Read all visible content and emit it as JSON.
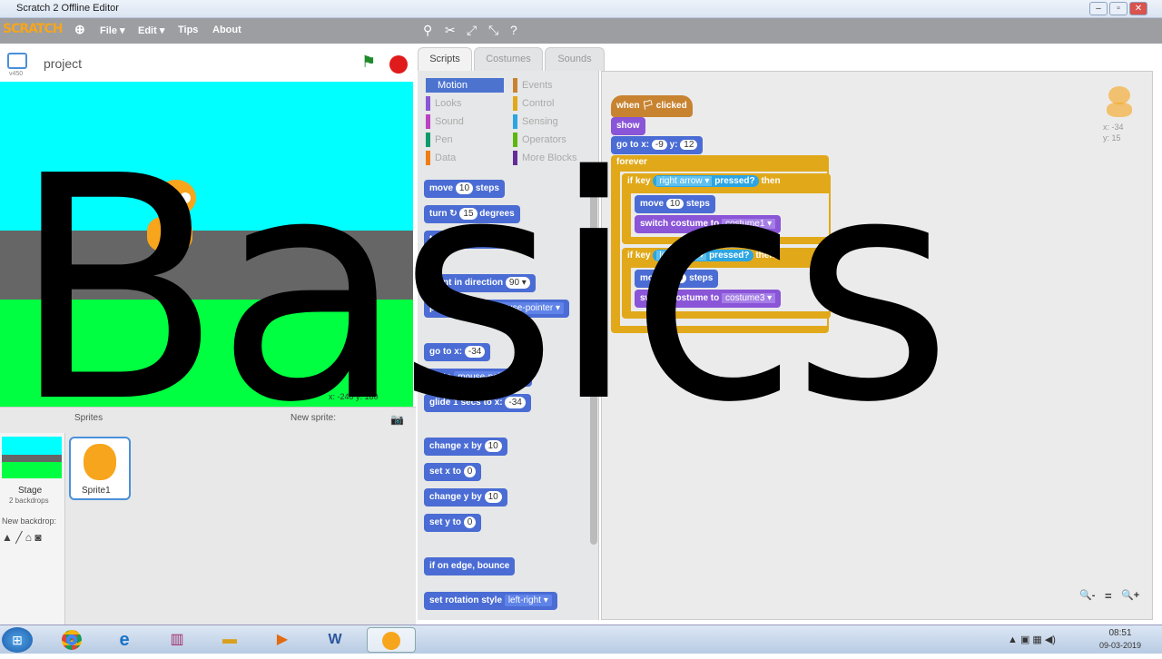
{
  "window": {
    "title": "Scratch 2 Offline Editor",
    "controls": [
      "–",
      "▫",
      "✕"
    ]
  },
  "menubar": {
    "logo": "SCRATCH",
    "items": [
      "File ▾",
      "Edit ▾",
      "Tips",
      "About"
    ]
  },
  "stage": {
    "project_name": "project",
    "version": "v450",
    "coords": "x: -240  y: 180"
  },
  "sprites": {
    "header": "Sprites",
    "new_sprite": "New sprite:",
    "stage_label": "Stage",
    "stage_backdrops": "2 backdrops",
    "new_backdrop": "New backdrop:",
    "sprite_name": "Sprite1"
  },
  "tabs": [
    "Scripts",
    "Costumes",
    "Sounds"
  ],
  "categories": {
    "left": [
      "Motion",
      "Looks",
      "Sound",
      "Pen",
      "Data"
    ],
    "right": [
      "Events",
      "Control",
      "Sensing",
      "Operators",
      "More Blocks"
    ]
  },
  "palette": {
    "move": "move",
    "move_val": "10",
    "steps": "steps",
    "turn_r": "turn ↻",
    "turn_r_val": "15",
    "degrees": "degrees",
    "turn_l": "turn ↺",
    "turn_l_val": "15",
    "point_dir": "point in direction",
    "point_dir_val": "90 ▾",
    "point_towards": "point towards",
    "point_towards_val": "mouse-pointer ▾",
    "goto_xy": "go to x:",
    "goto_xy_val": "-34",
    "goto": "go to",
    "goto_val": "mouse-pointer ▾",
    "glide": "glide 1 secs to x:",
    "glide_val": "-34",
    "change_x": "change x by",
    "change_x_val": "10",
    "set_x": "set x to",
    "set_x_val": "0",
    "change_y": "change y by",
    "change_y_val": "10",
    "set_y": "set y to",
    "set_y_val": "0",
    "bounce": "if on edge, bounce",
    "rotation": "set rotation style",
    "rotation_val": "left-right ▾"
  },
  "script": {
    "hat": "when 🏳 clicked",
    "show": "show",
    "goto": "go to x:",
    "goto_x": "-9",
    "goto_y_label": "y:",
    "goto_y": "12",
    "forever": "forever",
    "if1": "if  key",
    "if1_key": "right arrow ▾",
    "if1_pressed": "pressed?",
    "then": "then",
    "move1": "move",
    "move1_val": "10",
    "steps": "steps",
    "switch1": "switch costume to",
    "switch1_val": "costume1 ▾",
    "if2": "if  key",
    "if2_key": "left arrow ▾",
    "if2_pressed": "pressed?",
    "move2": "move",
    "move2_val": "-10",
    "switch2": "switch costume to",
    "switch2_val": "costume3 ▾"
  },
  "sprite_info": {
    "x": "x: -34",
    "y": "y: 15"
  },
  "zoom": {
    "out": "🔍-",
    "reset": "=",
    "in": "🔍+"
  },
  "overlay_text": "Basics",
  "taskbar": {
    "time": "08:51",
    "date": "09-03-2019"
  },
  "colors": {
    "motion": "#4a6cd4",
    "looks": "#8a55d7",
    "control": "#e1a91a",
    "sensing": "#2ca5e2",
    "stage_sky": "#00ffff",
    "stage_road": "#666666",
    "stage_grass": "#00ff40"
  }
}
